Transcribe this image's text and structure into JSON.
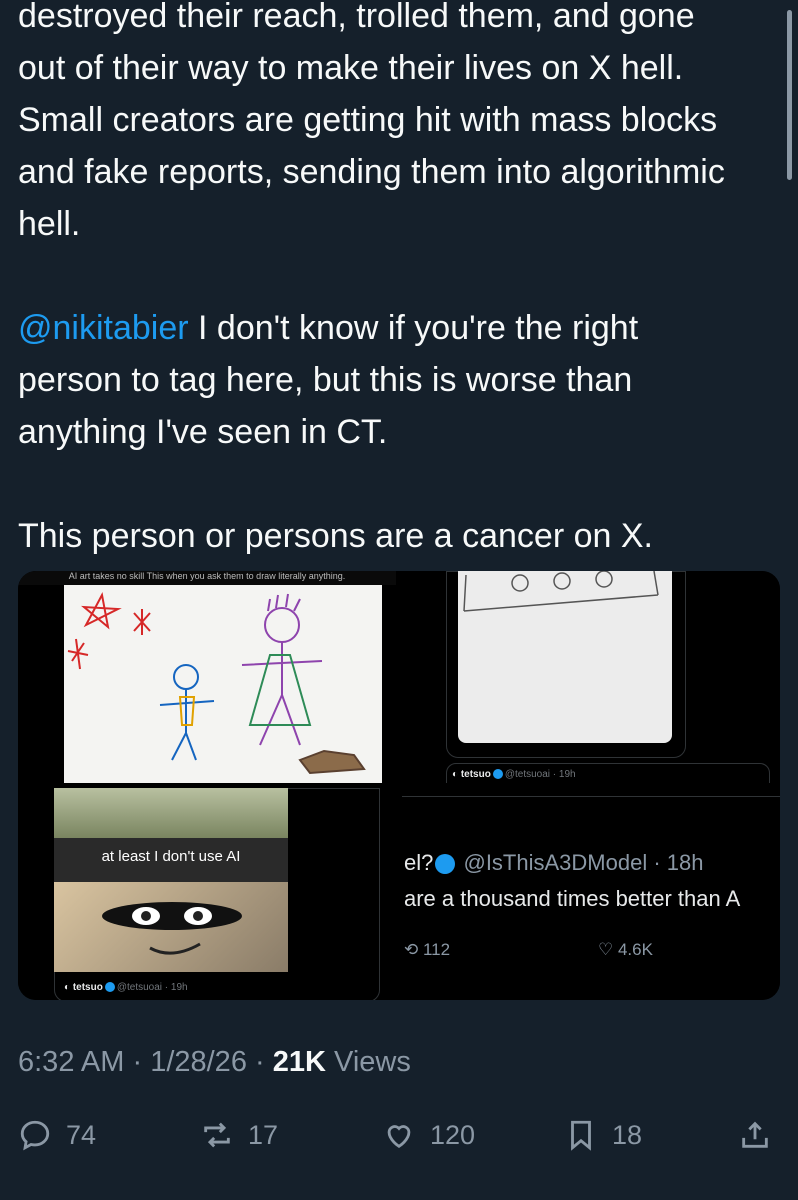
{
  "tweet": {
    "para1_lines": [
      "destroyed their reach, trolled them, and gone",
      "out of their way to make their lives on X hell.",
      "Small creators are getting hit with mass blocks",
      "and fake reports, sending them into algorithmic",
      "hell."
    ],
    "mention": "@nikitabier",
    "para2_line1_rest": " I don't know if you're the right",
    "para2_line2": "person to tag here, but this is worse than",
    "para2_line3": "anything I've seen in CT.",
    "para3": "This person or persons are a cancer on X."
  },
  "media": {
    "cell1_caption": "AI art takes no skill  This when you ask them to draw literally anything.",
    "cell2_author": "tetsuo",
    "cell2_handle": "@tetsuoai · 19h",
    "cell3_caption": "at least I don't use AI",
    "cell3_author": "tetsuo",
    "cell3_handle": "@tetsuoai · 19h",
    "cell4_name_fragment": "el?",
    "cell4_handle": "@IsThisA3DModel · 18h",
    "cell4_text": "are a thousand times better than A",
    "cell4_reposts": "112",
    "cell4_likes": "4.6K"
  },
  "meta": {
    "time": "6:32 AM",
    "date": "1/28/26",
    "views_count": "21K",
    "views_label": "Views"
  },
  "actions": {
    "replies": "74",
    "reposts": "17",
    "likes": "120",
    "bookmarks": "18"
  },
  "icons": [
    "reply-icon",
    "repost-icon",
    "like-icon",
    "bookmark-icon",
    "share-icon",
    "verified-badge-icon"
  ],
  "colors": {
    "background": "#15202b",
    "mention": "#1d9bf0",
    "muted": "#8b98a5",
    "text": "#f7f9f9"
  }
}
